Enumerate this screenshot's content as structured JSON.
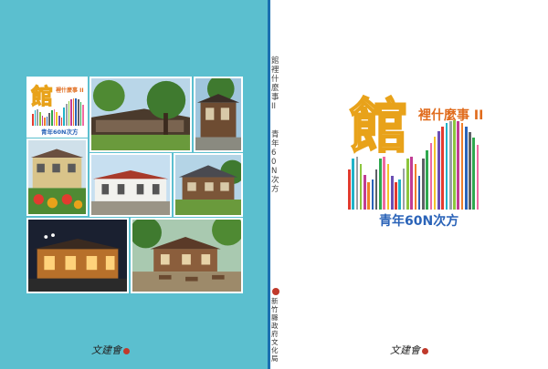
{
  "logo": {
    "main_char": "館",
    "subtitle": "裡什麼事 II",
    "tagline": "青年60N次方"
  },
  "spine": {
    "title": "館裡什麼事II",
    "subtitle": "青年60N次方",
    "publisher": "新竹縣政府文化局"
  },
  "signature": {
    "text": "文建會"
  },
  "colors": {
    "back_cover": "#5bbfcf",
    "spine_line": "#1a6fb0",
    "logo_orange": "#e8a21a",
    "subtitle_orange": "#e06b1c",
    "tagline_blue": "#2a63b8"
  },
  "photos": [
    "tree-courtyard-building",
    "japanese-style-house",
    "yellow-house-flower-garden",
    "white-building-red-roof",
    "wooden-house-porch",
    "lit-building-at-night",
    "cafe-patio-tables"
  ]
}
